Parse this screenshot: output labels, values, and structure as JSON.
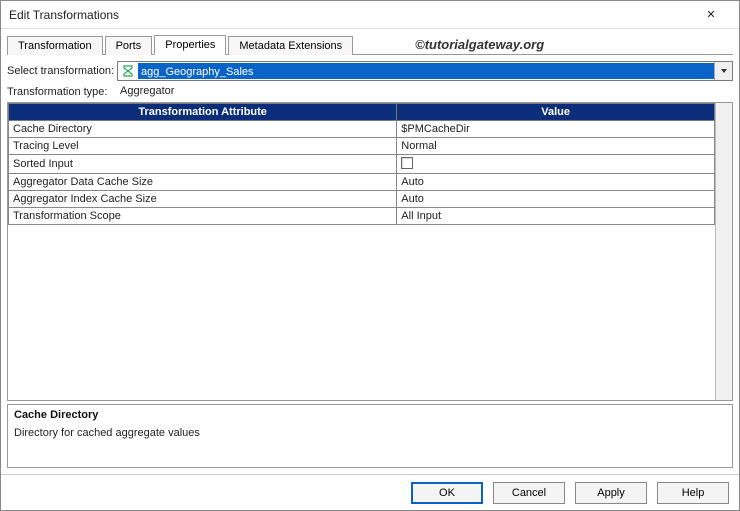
{
  "window": {
    "title": "Edit Transformations"
  },
  "tabs": {
    "t0": "Transformation",
    "t1": "Ports",
    "t2": "Properties",
    "t3": "Metadata Extensions"
  },
  "watermark": "©tutorialgateway.org",
  "form": {
    "select_label": "Select transformation:",
    "select_value": "agg_Geography_Sales",
    "type_label": "Transformation type:",
    "type_value": "Aggregator"
  },
  "table": {
    "head_attr": "Transformation Attribute",
    "head_val": "Value",
    "rows": [
      {
        "attr": "Cache Directory",
        "val": "$PMCacheDir",
        "kind": "text"
      },
      {
        "attr": "Tracing Level",
        "val": "Normal",
        "kind": "text"
      },
      {
        "attr": "Sorted Input",
        "val": "",
        "kind": "checkbox"
      },
      {
        "attr": "Aggregator Data Cache Size",
        "val": "Auto",
        "kind": "text"
      },
      {
        "attr": "Aggregator Index Cache Size",
        "val": "Auto",
        "kind": "text"
      },
      {
        "attr": "Transformation Scope",
        "val": "All Input",
        "kind": "text"
      }
    ]
  },
  "desc": {
    "title": "Cache Directory",
    "body": "Directory for cached aggregate values"
  },
  "buttons": {
    "ok": "OK",
    "cancel": "Cancel",
    "apply": "Apply",
    "help": "Help"
  }
}
